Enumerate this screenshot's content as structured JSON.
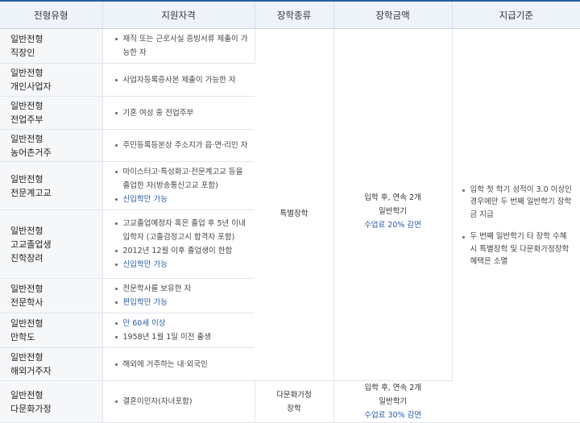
{
  "headers": [
    "전형유형",
    "지원자격",
    "장학종류",
    "장학금액",
    "지급기준"
  ],
  "rows": [
    {
      "type": [
        "일반전형",
        "직장인"
      ],
      "qual": [
        {
          "text": "재직 또는 근로사실 증빙서류 제출이 가능한 자",
          "blue": false
        }
      ]
    },
    {
      "type": [
        "일반전형",
        "개인사업자"
      ],
      "qual": [
        {
          "text": "사업자등록증사본 제출이 가능한 자",
          "blue": false
        }
      ]
    },
    {
      "type": [
        "일반전형",
        "전업주부"
      ],
      "qual": [
        {
          "text": "기혼 여성 중 전업주부",
          "blue": false
        }
      ]
    },
    {
      "type": [
        "일반전형",
        "농어촌거주"
      ],
      "qual": [
        {
          "text": "주민등록등본상 주소지가 읍·면·리인 자",
          "blue": false
        }
      ]
    },
    {
      "type": [
        "일반전형",
        "전문계고교"
      ],
      "qual": [
        {
          "text": "마이스터고·특성화고·전문계고교 등을 졸업한 자(방송통신고교 포함)",
          "blue": false
        },
        {
          "text": "신입학만 가능",
          "blue": true
        }
      ]
    },
    {
      "type": [
        "일반전형",
        "고교졸업생",
        "진학장려"
      ],
      "qual": [
        {
          "text": "고교졸업예정자 혹은 졸업 후 5년 이내 입학자 (고졸검정고시 합격자 포함)",
          "blue": false
        },
        {
          "text": "2012년 12월 이후 졸업생이 한함",
          "blue": false
        },
        {
          "text": "신입학만 가능",
          "blue": true
        }
      ]
    },
    {
      "type": [
        "일반전형",
        "전문학사"
      ],
      "qual": [
        {
          "text": "전문학사를 보유한 자",
          "blue": false
        },
        {
          "text": "편입학만 가능",
          "blue": true
        }
      ]
    },
    {
      "type": [
        "일반전형",
        "만학도"
      ],
      "qual": [
        {
          "text": "만 60세 이상",
          "blue": true
        },
        {
          "text": "1958년 1월 1일 이전 출생",
          "blue": false
        }
      ]
    },
    {
      "type": [
        "일반전형",
        "해외거주자"
      ],
      "qual": [
        {
          "text": "해외에 거주하는 내·외국인",
          "blue": false
        }
      ]
    },
    {
      "type": [
        "일반전형",
        "다문화가정"
      ],
      "qual": [
        {
          "text": "결혼이민자(자녀포함)",
          "blue": false
        }
      ]
    }
  ],
  "scholarship_special": {
    "kind": "특별장학",
    "amount_lines": [
      "입학 후, 연속 2개",
      "일반학기"
    ],
    "amount_reduction": "수업료 20% 감면"
  },
  "scholarship_multicultural": {
    "kind_lines": [
      "다문화가정",
      "장학"
    ],
    "amount_lines": [
      "입학 후, 연속 2개",
      "일반학기"
    ],
    "amount_reduction": "수업료 30% 감면"
  },
  "criteria": [
    "입학 첫 학기 성적이 3.0 이상인 경우에만 두 번째 일반학기 장학금 지급",
    "두 번째 일반학기 타 장학 수혜 시 특별장학 및 다문화가정장학 혜택은 소멸"
  ],
  "colors": {
    "accent": "#2a5ba8",
    "header_bg": "#eef3fa",
    "type_bg": "#f6f7f9"
  }
}
